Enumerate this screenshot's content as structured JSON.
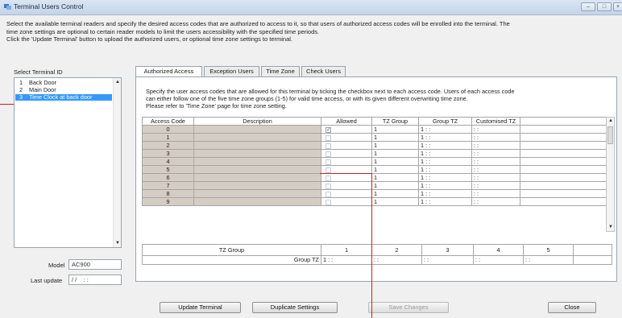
{
  "window": {
    "title": "Terminal Users Control"
  },
  "description": [
    "Select the available terminal readers and specify the desired access codes that are authorized to access to it, so that users of authorized access codes will be enrolled into the terminal. The",
    "time zone settings are optional to certain reader models to limit the users accessibility with the specified time periods.",
    "Click the 'Update Terminal' button to upload the authorized users, or optional time zone settings to terminal."
  ],
  "terminal": {
    "select_label": "Select Terminal ID",
    "items": [
      {
        "no": "1",
        "name": "Back Door"
      },
      {
        "no": "2",
        "name": "Main Door"
      },
      {
        "no": "3",
        "name": "Time Clock at back door"
      }
    ],
    "model_label": "Model",
    "model_value": "AC900",
    "last_update_label": "Last update",
    "last_update_value": "/ /    : :"
  },
  "tabs": [
    "Authorized Access",
    "Exception Users",
    "Time Zone",
    "Check Users"
  ],
  "info": [
    "Specify the user access codes that are allowed for this terminal by ticking the checkbox next to each access code. Users of each access code",
    "can either follow one of the five time zone groups (1-5) for valid time access, or with its given different overwriting time zone.",
    "Please refer to 'Time Zone' page for time zone setting."
  ],
  "grid": {
    "headers": [
      "Access Code",
      "Description",
      "Allowed",
      "TZ Group",
      "Group TZ",
      "Customised TZ"
    ],
    "rows": [
      {
        "code": "0",
        "allowed": true,
        "tz": "1",
        "group": "1 : :",
        "custom": ": :"
      },
      {
        "code": "1",
        "allowed": false,
        "tz": "1",
        "group": "1 : :",
        "custom": ": :"
      },
      {
        "code": "2",
        "allowed": false,
        "tz": "1",
        "group": "1 : :",
        "custom": ": :"
      },
      {
        "code": "3",
        "allowed": false,
        "tz": "1",
        "group": "1 : :",
        "custom": ": :"
      },
      {
        "code": "4",
        "allowed": false,
        "tz": "1",
        "group": "1 : :",
        "custom": ": :"
      },
      {
        "code": "5",
        "allowed": false,
        "tz": "1",
        "group": "1 : :",
        "custom": ": :"
      },
      {
        "code": "6",
        "allowed": false,
        "tz": "1",
        "group": "1 : :",
        "custom": ": :"
      },
      {
        "code": "7",
        "allowed": false,
        "tz": "1",
        "group": "1 : :",
        "custom": ": :"
      },
      {
        "code": "8",
        "allowed": false,
        "tz": "1",
        "group": "1 : :",
        "custom": ": :"
      },
      {
        "code": "9",
        "allowed": false,
        "tz": "1",
        "group": "1 : :",
        "custom": ": :"
      }
    ]
  },
  "tz_table": {
    "header": "TZ Group",
    "groups": [
      "1",
      "2",
      "3",
      "4",
      "5"
    ],
    "row_label": "Group TZ",
    "values": [
      "1 : :",
      ": :",
      ": :",
      ": :",
      ": :"
    ]
  },
  "buttons": {
    "update": "Update Terminal",
    "duplicate": "Duplicate Settings",
    "save": "Save Changes",
    "close": "Close"
  },
  "colors": {
    "selection": "#3399ff",
    "readonly_cell": "#d5cdc3",
    "annotation": "#d02020"
  }
}
